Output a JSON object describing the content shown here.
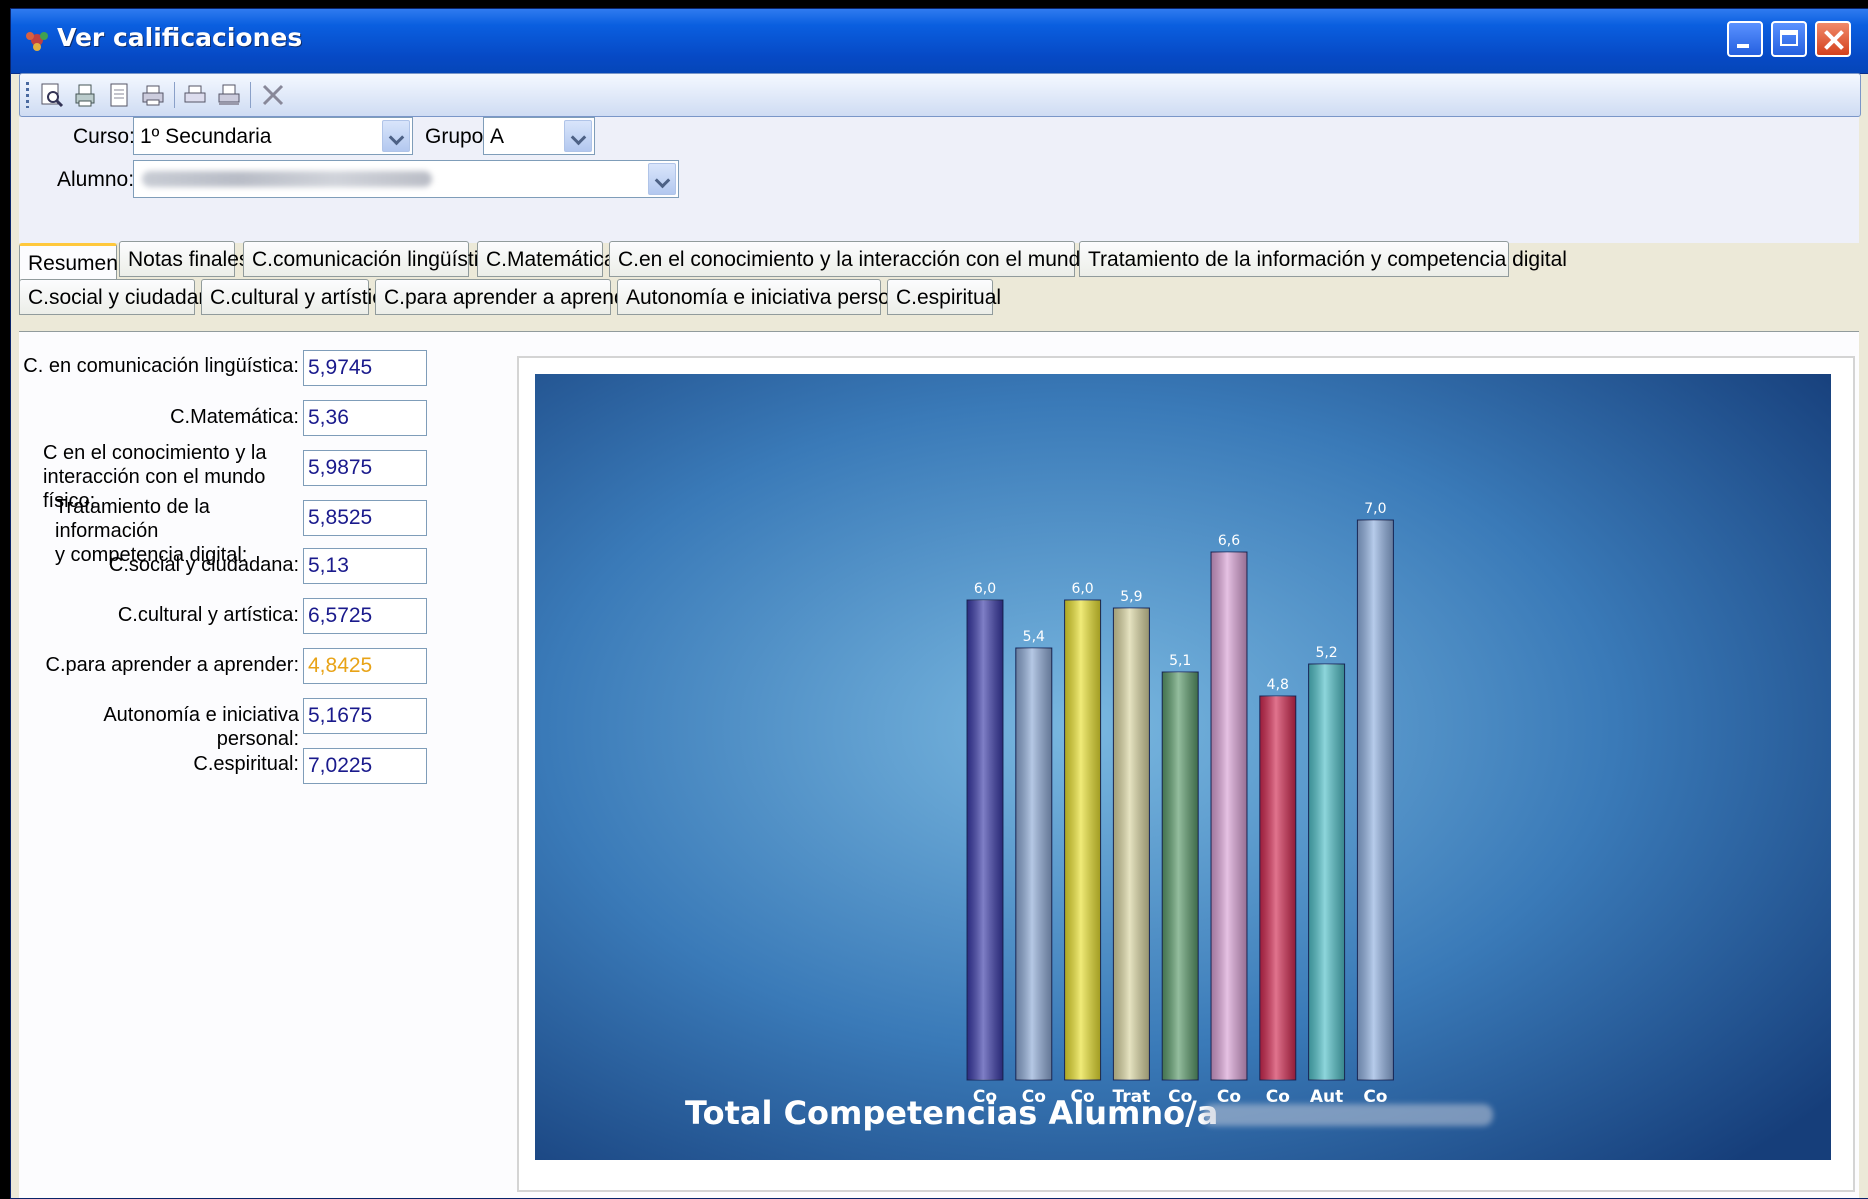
{
  "window": {
    "title": "Ver calificaciones"
  },
  "form": {
    "curso_label": "Curso:",
    "curso_value": "1º Secundaria",
    "grupo_label": "Grupo:",
    "grupo_value": "A",
    "alumno_label": "Alumno:"
  },
  "tabs": {
    "row1": [
      "Resumen",
      "Notas finales",
      "C.comunicación lingüística",
      "C.Matemática",
      "C.en el conocimiento y la interacción con el mundo físico",
      "Tratamiento de la información y competencia digital"
    ],
    "row2": [
      "C.social y ciudadana",
      "C.cultural y artística",
      "C.para aprender a aprender",
      "Autonomía e iniciativa personal",
      "C.espiritual"
    ]
  },
  "fields": [
    {
      "label": "C. en comunicación lingüística:",
      "value": "5,9745"
    },
    {
      "label": "C.Matemática:",
      "value": "5,36"
    },
    {
      "label": "C en el conocimiento y la",
      "label2": "interacción con el mundo físico:",
      "value": "5,9875"
    },
    {
      "label": "Tratamiento de la información",
      "label2": "y competencia digital:",
      "value": "5,8525"
    },
    {
      "label": "C.social y ciudadana:",
      "value": "5,13"
    },
    {
      "label": "C.cultural y artística:",
      "value": "6,5725"
    },
    {
      "label": "C.para aprender a aprender:",
      "value": "4,8425"
    },
    {
      "label": "Autonomía e iniciativa personal:",
      "value": "5,1675"
    },
    {
      "label": "C.espiritual:",
      "value": "7,0225"
    }
  ],
  "chart_data": {
    "type": "bar",
    "title": "Total Competencias Alumno/a",
    "categories": [
      "Co",
      "Co",
      "Co",
      "Trat",
      "Co",
      "Co",
      "Co",
      "Aut",
      "Co"
    ],
    "values": [
      6.0,
      5.4,
      6.0,
      5.9,
      5.1,
      6.6,
      4.8,
      5.2,
      7.0
    ],
    "data_labels": [
      "6,0",
      "5,4",
      "6,0",
      "5,9",
      "5,1",
      "6,6",
      "4,8",
      "5,2",
      "7,0"
    ],
    "colors": [
      "#3a3aa8",
      "#8eaad6",
      "#e8e030",
      "#d8d4a0",
      "#5a9a6a",
      "#d8a0d4",
      "#d02850",
      "#50c0c8",
      "#90b0e0"
    ],
    "ylim": [
      0,
      7.5
    ],
    "grid": false,
    "background": "#1e4a8a"
  }
}
